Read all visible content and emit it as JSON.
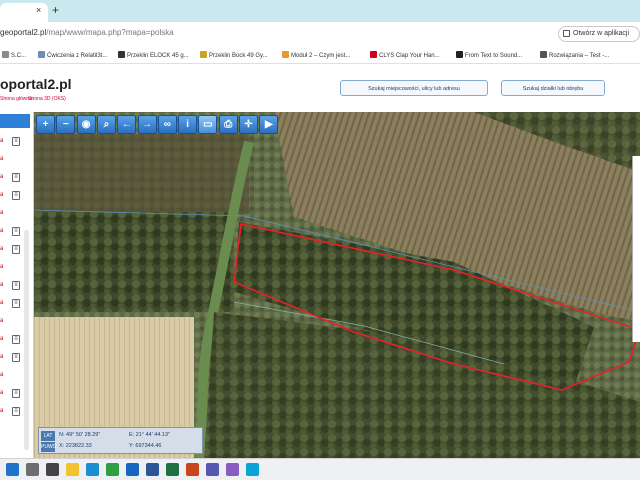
{
  "browser": {
    "tab_close": "×",
    "new_tab": "+",
    "url_host": "geoportal2.pl",
    "url_path": "/map/www/mapa.php?mapa=polska",
    "app_button_label": "Otwórz w aplikacji"
  },
  "bookmarks": [
    {
      "label": "S.C...",
      "color": "#8a8a8a"
    },
    {
      "label": "Ćwiczenia z Relatil3t...",
      "color": "#6b8fb8"
    },
    {
      "label": "Przeklin ELOCK 45 g...",
      "color": "#333333"
    },
    {
      "label": "Przeklin Bock 49 Gy...",
      "color": "#c9a227"
    },
    {
      "label": "Moduł 2 – Czym jest...",
      "color": "#e39b2f"
    },
    {
      "label": "CLYS Clap Your Han...",
      "color": "#d0021b"
    },
    {
      "label": "From Text to Sound...",
      "color": "#222222"
    },
    {
      "label": "Rozwiązania – Test -...",
      "color": "#555555"
    }
  ],
  "page": {
    "title": "oportal2.pl",
    "breadcrumb": [
      "Strona główna",
      "Strona 3D (OKS)"
    ],
    "search_address_button": "Szukaj miejscowości, ulicy lub adresu",
    "search_parcel_button": "Szukaj działki lub obrębu"
  },
  "left_panel": {
    "items": [
      "a",
      "a",
      "a",
      "a",
      "a",
      "a",
      "a",
      "a",
      "a",
      "a",
      "a",
      "a",
      "a",
      "a",
      "a",
      "a"
    ],
    "doc_icon_glyph": "≡"
  },
  "map": {
    "tools": [
      {
        "glyph": "+",
        "name": "zoom-in"
      },
      {
        "glyph": "−",
        "name": "zoom-out"
      },
      {
        "glyph": "◉",
        "name": "globe"
      },
      {
        "glyph": "⌕",
        "name": "magnify"
      },
      {
        "glyph": "←",
        "name": "back"
      },
      {
        "glyph": "→",
        "name": "forward"
      },
      {
        "glyph": "∞",
        "name": "link"
      },
      {
        "glyph": "i",
        "name": "info"
      },
      {
        "glyph": "▭",
        "name": "measure"
      },
      {
        "glyph": "⎙",
        "name": "print"
      },
      {
        "glyph": "✛",
        "name": "locate"
      },
      {
        "glyph": "▶",
        "name": "video"
      }
    ],
    "active_tool_index": 8,
    "parcel_color": "#e8202a",
    "coordinates": {
      "label_top": "LAT",
      "label_bottom": "PUWG",
      "lat": "N: 49° 50' 28.29\"",
      "lon": "E: 21° 44' 44.13\"",
      "x": "X: 223822.33",
      "y": "Y: 697344.46"
    }
  },
  "taskbar": {
    "icons": [
      {
        "name": "windows",
        "color": "#1f73c9"
      },
      {
        "name": "search",
        "color": "#6d6d6d"
      },
      {
        "name": "task-view",
        "color": "#444444"
      },
      {
        "name": "explorer",
        "color": "#f2c230"
      },
      {
        "name": "edge",
        "color": "#1a8ed0"
      },
      {
        "name": "chrome",
        "color": "#2f9e44"
      },
      {
        "name": "mail",
        "color": "#1667c2"
      },
      {
        "name": "word",
        "color": "#2b5797"
      },
      {
        "name": "excel",
        "color": "#1d7044"
      },
      {
        "name": "powerpoint",
        "color": "#c8461d"
      },
      {
        "name": "teams",
        "color": "#5558af"
      },
      {
        "name": "app",
        "color": "#8a5cc2"
      },
      {
        "name": "photos",
        "color": "#0aa3d6"
      }
    ]
  }
}
